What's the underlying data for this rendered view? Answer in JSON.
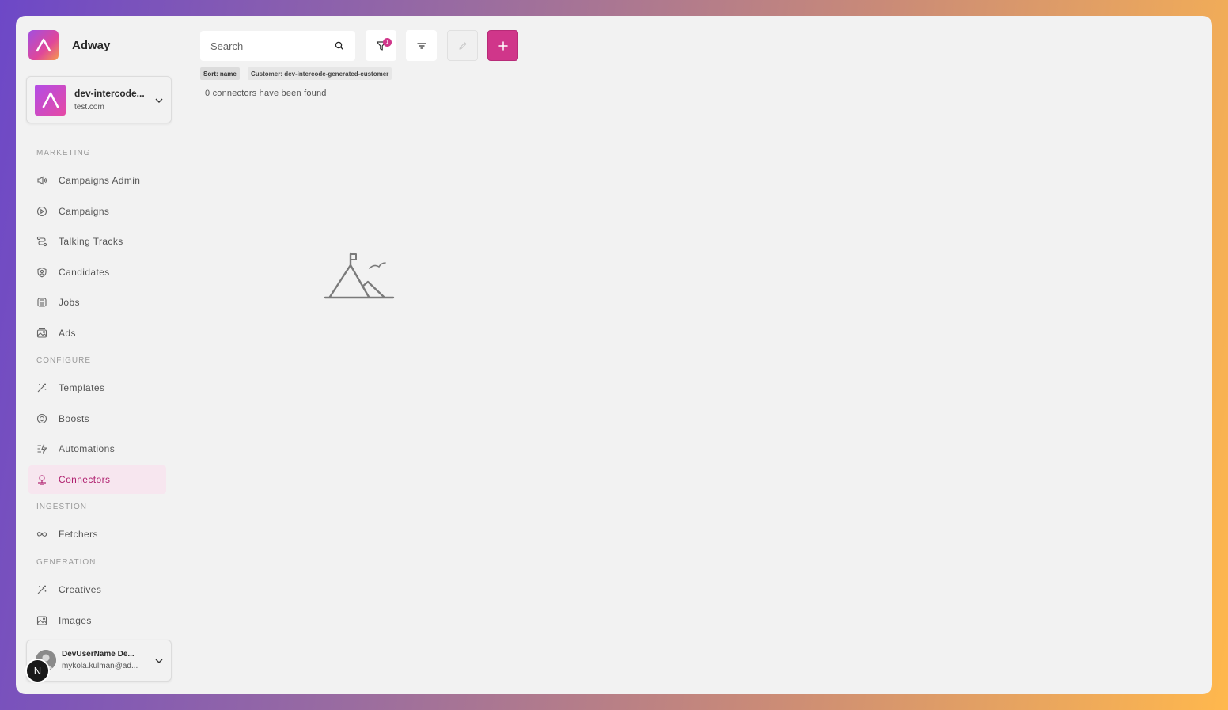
{
  "brand": {
    "name": "Adway"
  },
  "org": {
    "name": "dev-intercode...",
    "domain": "test.com"
  },
  "sidebar": {
    "sections": [
      {
        "label": "MARKETING"
      },
      {
        "label": "CONFIGURE"
      },
      {
        "label": "INGESTION"
      },
      {
        "label": "GENERATION"
      }
    ],
    "items": [
      {
        "label": "Campaigns Admin",
        "icon": "megaphone-icon"
      },
      {
        "label": "Campaigns",
        "icon": "play-circle-icon"
      },
      {
        "label": "Talking Tracks",
        "icon": "route-icon"
      },
      {
        "label": "Candidates",
        "icon": "user-shield-icon"
      },
      {
        "label": "Jobs",
        "icon": "job-icon"
      },
      {
        "label": "Ads",
        "icon": "image-stack-icon"
      },
      {
        "label": "Templates",
        "icon": "magic-wand-icon"
      },
      {
        "label": "Boosts",
        "icon": "coin-icon"
      },
      {
        "label": "Automations",
        "icon": "automation-icon"
      },
      {
        "label": "Connectors",
        "icon": "connector-icon",
        "active": true
      },
      {
        "label": "Fetchers",
        "icon": "infinity-icon"
      },
      {
        "label": "Creatives",
        "icon": "magic-wand-icon"
      },
      {
        "label": "Images",
        "icon": "image-icon"
      }
    ]
  },
  "user": {
    "name": "DevUserName De...",
    "email": "mykola.kulman@ad..."
  },
  "n_badge": "N",
  "toolbar": {
    "search_placeholder": "Search",
    "filter_badge": "1"
  },
  "chips": {
    "sort": "Sort: name",
    "customer": "Customer: dev-intercode-generated-customer"
  },
  "results": {
    "count_text": "0 connectors have been found"
  },
  "colors": {
    "accent": "#d0368a",
    "active_bg": "#f7e6ef",
    "active_text": "#b0206f"
  }
}
